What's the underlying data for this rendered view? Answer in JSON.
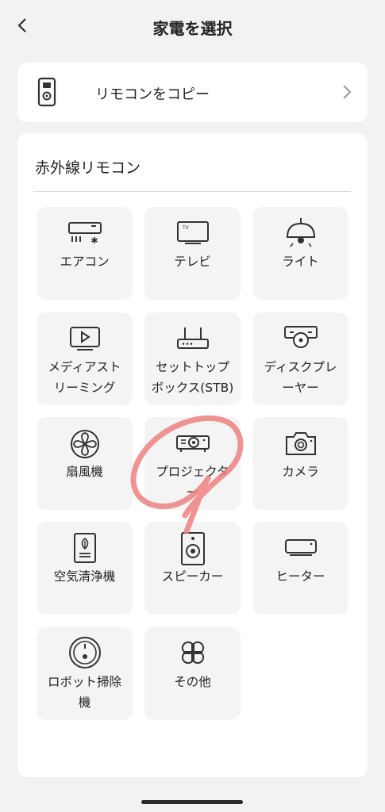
{
  "header": {
    "title": "家電を選択",
    "back_icon": "chevron-left-icon"
  },
  "copy_remote": {
    "label": "リモコンをコピー",
    "icon": "remote-icon"
  },
  "ir_section": {
    "title": "赤外線リモコン",
    "devices": [
      {
        "label": "エアコン",
        "icon": "air-conditioner-icon"
      },
      {
        "label": "テレビ",
        "icon": "tv-icon"
      },
      {
        "label": "ライト",
        "icon": "light-icon"
      },
      {
        "label": "メディアストリーミング",
        "line1": "メディアスト",
        "line2": "リーミング",
        "icon": "media-streaming-icon"
      },
      {
        "label": "セットトップボックス(STB)",
        "line1": "セットトップ",
        "line2": "ボックス(STB)",
        "icon": "set-top-box-icon"
      },
      {
        "label": "ディスクプレーヤー",
        "line1": "ディスクプレ",
        "line2": "ーヤー",
        "icon": "disc-player-icon"
      },
      {
        "label": "扇風機",
        "icon": "fan-icon"
      },
      {
        "label": "プロジェクター",
        "line1": "プロジェクタ",
        "line2": "ー",
        "icon": "projector-icon"
      },
      {
        "label": "カメラ",
        "icon": "camera-icon"
      },
      {
        "label": "空気清浄機",
        "icon": "air-purifier-icon"
      },
      {
        "label": "スピーカー",
        "icon": "speaker-icon"
      },
      {
        "label": "ヒーター",
        "icon": "heater-icon"
      },
      {
        "label": "ロボット掃除機",
        "line1": "ロボット掃除",
        "line2": "機",
        "icon": "robot-vacuum-icon"
      },
      {
        "label": "その他",
        "icon": "other-icon"
      }
    ]
  },
  "colors": {
    "annotation": "#ec8080",
    "background": "#f2f2f2",
    "tile": "#f4f4f4"
  }
}
